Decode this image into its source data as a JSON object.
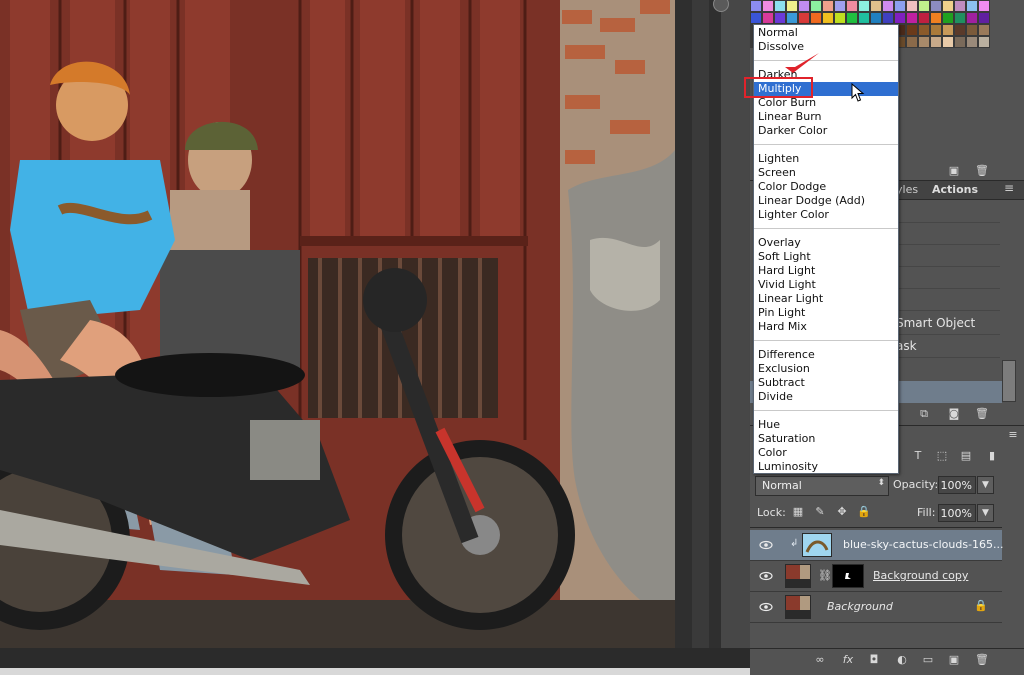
{
  "colors": {
    "panel_bg": "#535353",
    "highlight": "#2f6fd1",
    "annotation_red": "#e0232b",
    "selected_layer": "#6f7d8c"
  },
  "blend_menu": {
    "groups": [
      [
        "Normal",
        "Dissolve"
      ],
      [
        "Darken",
        "Multiply",
        "Color Burn",
        "Linear Burn",
        "Darker Color"
      ],
      [
        "Lighten",
        "Screen",
        "Color Dodge",
        "Linear Dodge (Add)",
        "Lighter Color"
      ],
      [
        "Overlay",
        "Soft Light",
        "Hard Light",
        "Vivid Light",
        "Linear Light",
        "Pin Light",
        "Hard Mix"
      ],
      [
        "Difference",
        "Exclusion",
        "Subtract",
        "Divide"
      ],
      [
        "Hue",
        "Saturation",
        "Color",
        "Luminosity"
      ]
    ],
    "highlighted": "Multiply"
  },
  "styles_panel": {
    "tabs": [
      "yles",
      "Actions"
    ],
    "rows": [
      "Smart Object",
      "ask"
    ]
  },
  "layers_panel": {
    "blend_mode": "Normal",
    "opacity_label": "Opacity:",
    "opacity": "100%",
    "lock_label": "Lock:",
    "fill_label": "Fill:",
    "fill": "100%",
    "layers": [
      {
        "name": "blue-sky-cactus-clouds-165...",
        "selected": true,
        "has_mask": false,
        "locked": false,
        "clipped": true
      },
      {
        "name": "Background copy",
        "selected": false,
        "has_mask": true,
        "locked": false,
        "clipped": false
      },
      {
        "name": "Background",
        "selected": false,
        "has_mask": false,
        "locked": true,
        "clipped": false
      }
    ],
    "footer_icons": [
      "link-icon",
      "fx-icon",
      "mask-icon",
      "adjustment-icon",
      "group-icon",
      "new-layer-icon",
      "trash-icon"
    ]
  },
  "icons": {
    "eye": "eye-icon",
    "lock": "lock-icon",
    "cursor": "arrow-cursor-icon",
    "check": "checkmark-annotation-icon"
  }
}
